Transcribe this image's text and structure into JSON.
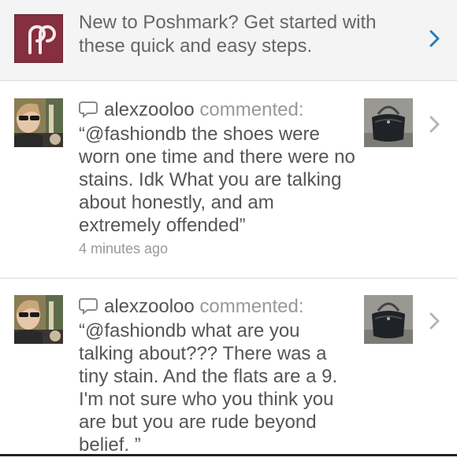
{
  "banner": {
    "text": "New to Poshmark? Get started with these quick and easy steps.",
    "icon": "poshmark-logo-icon",
    "chevron": "chevron-right-icon",
    "chevron_color": "#2a7ab8"
  },
  "notifications": [
    {
      "username": "alexzooloo",
      "verb": "commented:",
      "comment": "“@fashiondb the shoes were worn one time and there were no stains. Idk What you are talking about honestly, and am extremely offended”",
      "time": "4 minutes ago"
    },
    {
      "username": "alexzooloo",
      "verb": "commented:",
      "comment": "“@fashiondb what are you talking about??? There was a tiny stain. And the flats are a 9. I'm not sure who you think you are but you are rude beyond belief. ”"
    }
  ],
  "colors": {
    "logo_bg": "#862f3f",
    "banner_bg": "#f4f4f4",
    "muted_text": "#999999"
  }
}
